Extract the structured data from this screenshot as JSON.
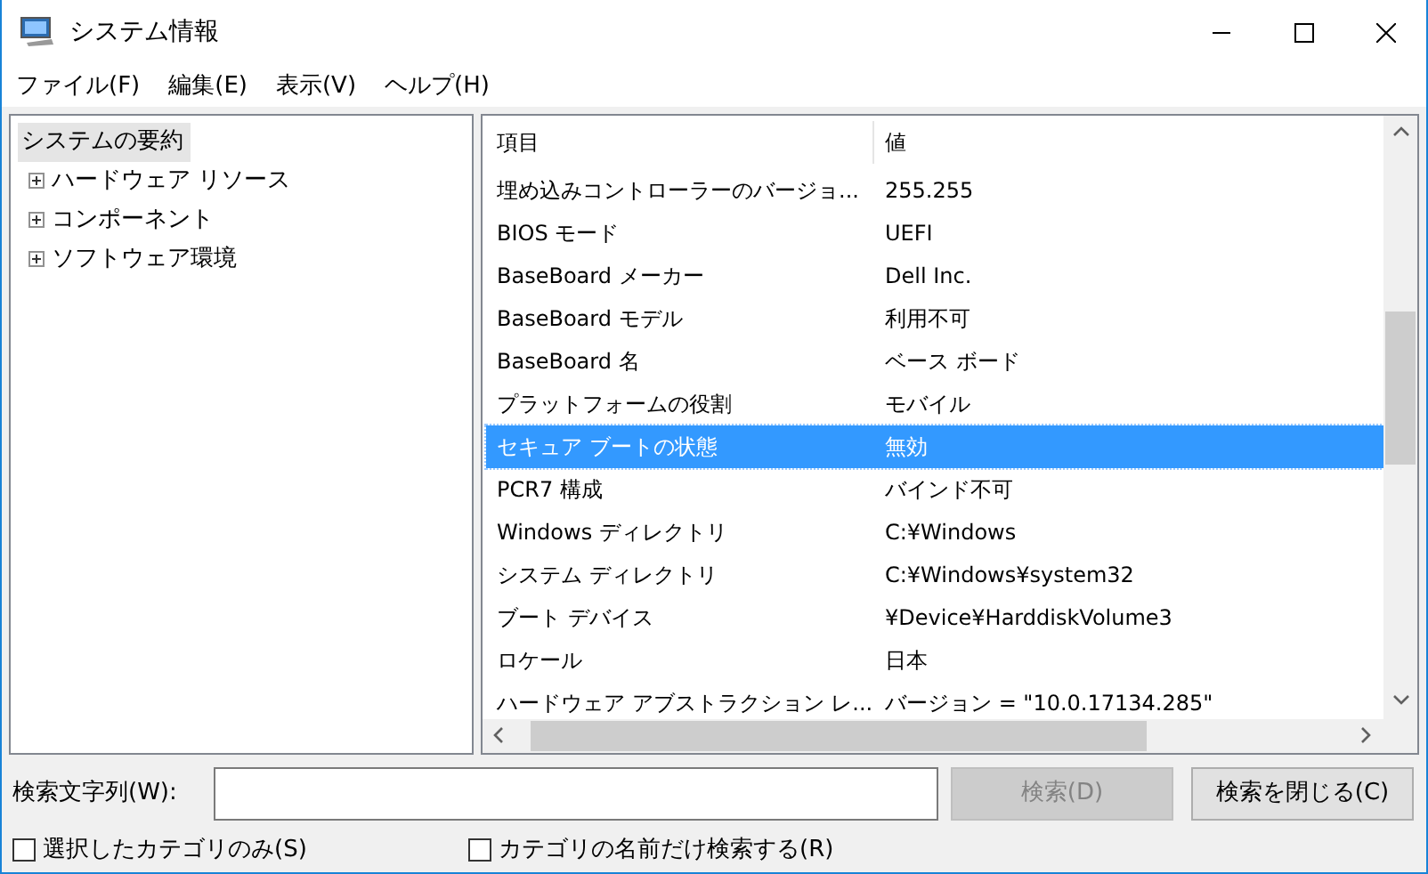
{
  "window": {
    "title": "システム情報"
  },
  "menu": [
    "ファイル(F)",
    "編集(E)",
    "表示(V)",
    "ヘルプ(H)"
  ],
  "tree": [
    {
      "label": "システムの要約",
      "selected": true,
      "children": [
        {
          "label": "ハードウェア リソース",
          "expanded": false
        },
        {
          "label": "コンポーネント",
          "expanded": false
        },
        {
          "label": "ソフトウェア環境",
          "expanded": false
        }
      ]
    }
  ],
  "table": {
    "columns": [
      "項目",
      "値"
    ],
    "rows": [
      {
        "cells": [
          "埋め込みコントローラーのバージョ...",
          "255.255"
        ],
        "selected": false
      },
      {
        "cells": [
          "BIOS モード",
          "UEFI"
        ],
        "selected": false
      },
      {
        "cells": [
          "BaseBoard メーカー",
          "Dell Inc."
        ],
        "selected": false
      },
      {
        "cells": [
          "BaseBoard モデル",
          "利用不可"
        ],
        "selected": false
      },
      {
        "cells": [
          "BaseBoard 名",
          "ベース ボード"
        ],
        "selected": false
      },
      {
        "cells": [
          "プラットフォームの役割",
          "モバイル"
        ],
        "selected": false
      },
      {
        "cells": [
          "セキュア ブートの状態",
          "無効"
        ],
        "selected": true
      },
      {
        "cells": [
          "PCR7 構成",
          "バインド不可"
        ],
        "selected": false
      },
      {
        "cells": [
          "Windows ディレクトリ",
          "C:¥Windows"
        ],
        "selected": false
      },
      {
        "cells": [
          "システム ディレクトリ",
          "C:¥Windows¥system32"
        ],
        "selected": false
      },
      {
        "cells": [
          "ブート デバイス",
          "¥Device¥HarddiskVolume3"
        ],
        "selected": false
      },
      {
        "cells": [
          "ロケール",
          "日本"
        ],
        "selected": false
      },
      {
        "cells": [
          "ハードウェア アブストラクション レ...",
          "バージョン = \"10.0.17134.285\""
        ],
        "selected": false
      }
    ]
  },
  "search": {
    "label": "検索文字列(W):",
    "buttons": [
      {
        "label": "検索(D)",
        "disabled": true
      },
      {
        "label": "検索を閉じる(C)",
        "disabled": false
      }
    ]
  },
  "options": [
    {
      "label": "選択したカテゴリのみ(S)",
      "checked": false
    },
    {
      "label": "カテゴリの名前だけ検索する(R)",
      "checked": false
    }
  ]
}
